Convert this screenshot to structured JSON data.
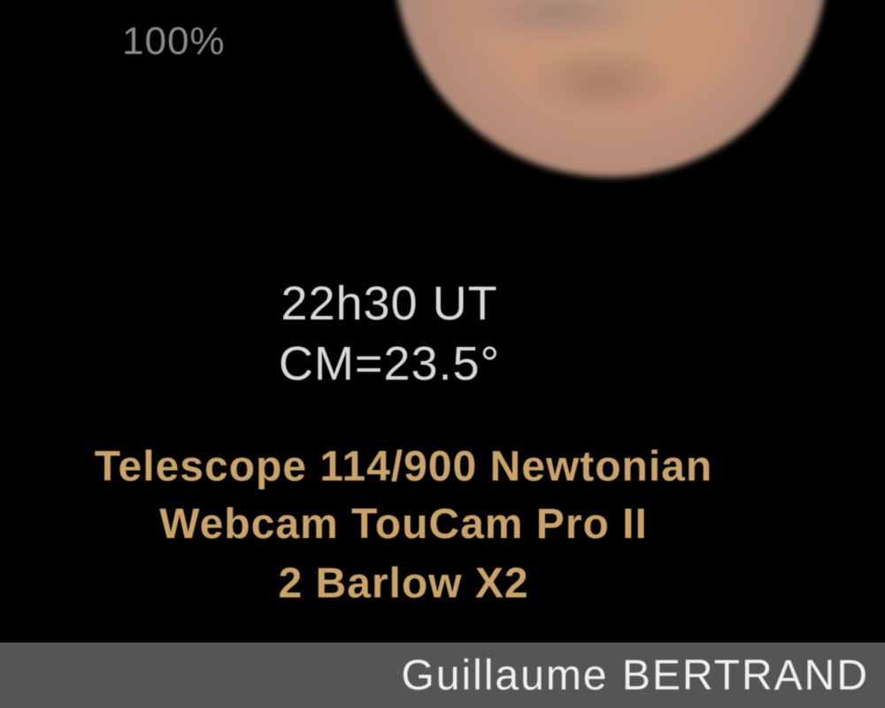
{
  "zoom_label": "100%",
  "observation": {
    "time": "22h30 UT",
    "cm": "CM=23.5°"
  },
  "equipment": {
    "telescope": "Telescope 114/900 Newtonian",
    "webcam": "Webcam TouCam Pro II",
    "barlow": "2 Barlow X2"
  },
  "footer": {
    "author": "Guillaume BERTRAND"
  },
  "colors": {
    "background": "#000000",
    "observation_text": "#d9d9d9",
    "equipment_text": "#c9a36a",
    "footer_bar": "#555555"
  }
}
